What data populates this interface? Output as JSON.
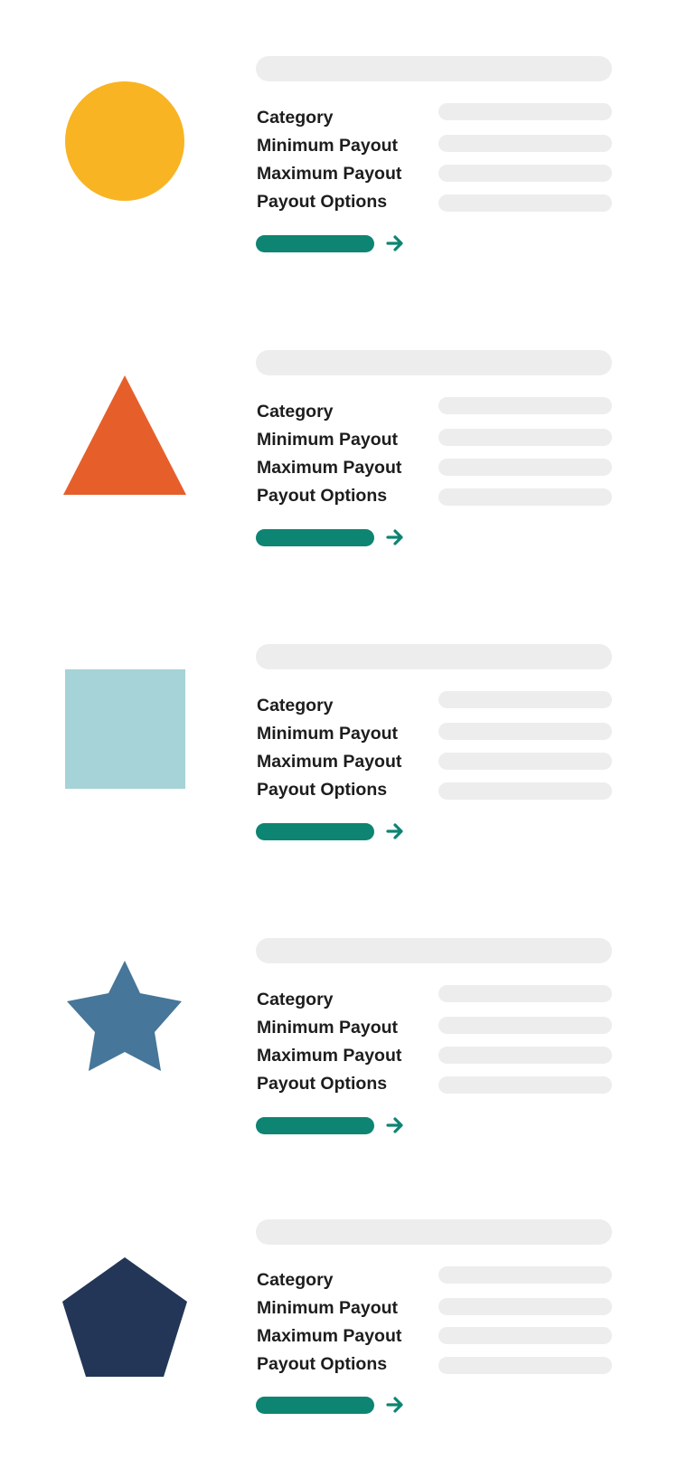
{
  "colors": {
    "accent": "#0e8473",
    "placeholder": "#ededed",
    "text": "#1d1d1d"
  },
  "cards": [
    {
      "shape": "circle-icon",
      "shape_color": "#f8b422",
      "labels": [
        "Category",
        "Minimum Payout",
        "Maximum Payout",
        "Payout Options"
      ]
    },
    {
      "shape": "triangle-icon",
      "shape_color": "#e65f2b",
      "labels": [
        "Category",
        "Minimum Payout",
        "Maximum Payout",
        "Payout Options"
      ]
    },
    {
      "shape": "square-icon",
      "shape_color": "#a5d3d7",
      "labels": [
        "Category",
        "Minimum Payout",
        "Maximum Payout",
        "Payout Options"
      ]
    },
    {
      "shape": "star-icon",
      "shape_color": "#467699",
      "labels": [
        "Category",
        "Minimum Payout",
        "Maximum Payout",
        "Payout Options"
      ]
    },
    {
      "shape": "pentagon-icon",
      "shape_color": "#233657",
      "labels": [
        "Category",
        "Minimum Payout",
        "Maximum Payout",
        "Payout Options"
      ]
    }
  ]
}
